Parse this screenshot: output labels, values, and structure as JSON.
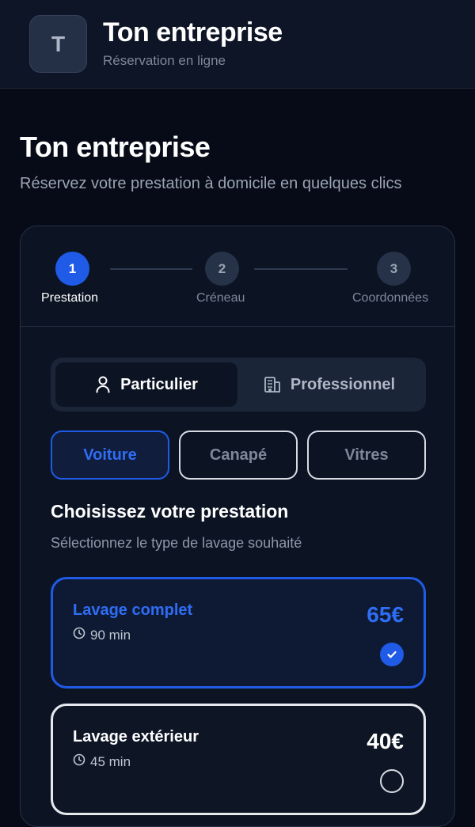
{
  "header": {
    "logo_letter": "T",
    "brand_name": "Ton entreprise",
    "brand_subtitle": "Réservation en ligne"
  },
  "page": {
    "title": "Ton entreprise",
    "subtitle": "Réservez votre prestation à domicile en quelques clics"
  },
  "steps": [
    {
      "number": "1",
      "label": "Prestation",
      "state": "active"
    },
    {
      "number": "2",
      "label": "Créneau",
      "state": "todo"
    },
    {
      "number": "3",
      "label": "Coordonnées",
      "state": "todo"
    }
  ],
  "customer_type": {
    "options": [
      {
        "label": "Particulier",
        "icon": "user-icon",
        "selected": true
      },
      {
        "label": "Professionnel",
        "icon": "building-icon",
        "selected": false
      }
    ]
  },
  "categories": [
    {
      "label": "Voiture",
      "selected": true
    },
    {
      "label": "Canapé",
      "selected": false
    },
    {
      "label": "Vitres",
      "selected": false
    }
  ],
  "services_section": {
    "title": "Choisissez votre prestation",
    "subtitle": "Sélectionnez le type de lavage souhaité",
    "items": [
      {
        "name": "Lavage complet",
        "duration": "90 min",
        "price": "65€",
        "selected": true
      },
      {
        "name": "Lavage extérieur",
        "duration": "45 min",
        "price": "40€",
        "selected": false
      }
    ]
  },
  "colors": {
    "accent": "#1f5be6",
    "background": "#060b17",
    "card": "#0c1424"
  }
}
